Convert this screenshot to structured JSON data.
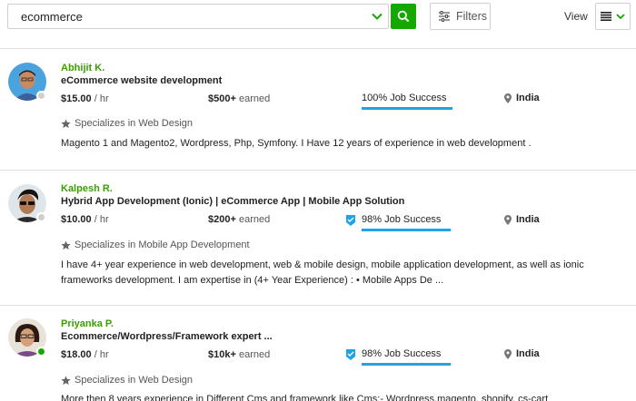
{
  "search": {
    "value": "ecommerce",
    "placeholder": ""
  },
  "toolbar": {
    "filters_label": "Filters",
    "view_label": "View"
  },
  "colors": {
    "accent_green": "#14a800",
    "name_green": "#37a000",
    "progress_blue": "#1fa3e4",
    "online_green": "#14a800",
    "offline_gray": "#d0d0d0"
  },
  "results": [
    {
      "name": "Abhijit K.",
      "title": "eCommerce website development",
      "rate_amount": "$15.00",
      "rate_unit": " / hr",
      "earned_amount": "$500+",
      "earned_label": " earned",
      "job_success": "100% Job Success",
      "job_success_pct": 100,
      "top_rated": false,
      "location": "India",
      "online": false,
      "specializes": "Specializes in Web Design",
      "description": "Magento 1 and Magento2, Wordpress, Php, Symfony. I Have 12 years of experience in web development ."
    },
    {
      "name": "Kalpesh R.",
      "title": "Hybrid App Development (Ionic) | eCommerce App | Mobile App Solution",
      "rate_amount": "$10.00",
      "rate_unit": " / hr",
      "earned_amount": "$200+",
      "earned_label": " earned",
      "job_success": "98% Job Success",
      "job_success_pct": 98,
      "top_rated": true,
      "location": "India",
      "online": false,
      "specializes": "Specializes in Mobile App Development",
      "description": "I have 4+ year experience in web development, web & mobile design, mobile application development, as well as ionic frameworks development. I am expertise in (4+ Year Experience) : • Mobile Apps De ..."
    },
    {
      "name": "Priyanka P.",
      "title": "Ecommerce/Wordpress/Framework expert ...",
      "rate_amount": "$18.00",
      "rate_unit": " / hr",
      "earned_amount": "$10k+",
      "earned_label": " earned",
      "job_success": "98% Job Success",
      "job_success_pct": 98,
      "top_rated": true,
      "location": "India",
      "online": true,
      "specializes": "Specializes in Web Design",
      "description": "More then 8 years experience in Different Cms and framework like Cms:- Wordpress,magento, shopify, cs-cart"
    }
  ],
  "icons": {
    "search": "search-icon",
    "chevron": "chevron-down-icon",
    "filters": "sliders-icon",
    "view": "list-view-icon",
    "location": "map-pin-icon",
    "star": "star-icon",
    "badge": "top-rated-badge-icon"
  }
}
